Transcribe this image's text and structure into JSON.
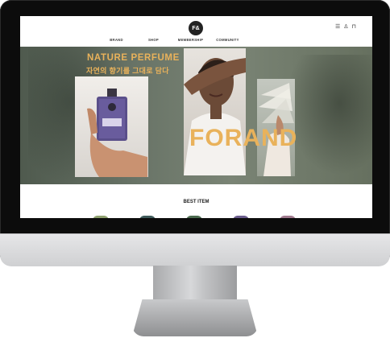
{
  "site": {
    "logo_text": "F&",
    "nav": [
      "BRAND",
      "SHOP",
      "MEMBERSHIP",
      "COMMUNITY"
    ],
    "util_icons": [
      "menu-icon",
      "user-icon",
      "bag-icon"
    ]
  },
  "hero": {
    "title_en": "NATURE PERFUME",
    "title_ko": "자연의 향기를 그대로 담다",
    "brand_name": "FORAND"
  },
  "section": {
    "best_item_title": "BEST ITEM"
  },
  "colors": {
    "accent": "#e9b25b",
    "hero_bg": "#6b7568"
  }
}
